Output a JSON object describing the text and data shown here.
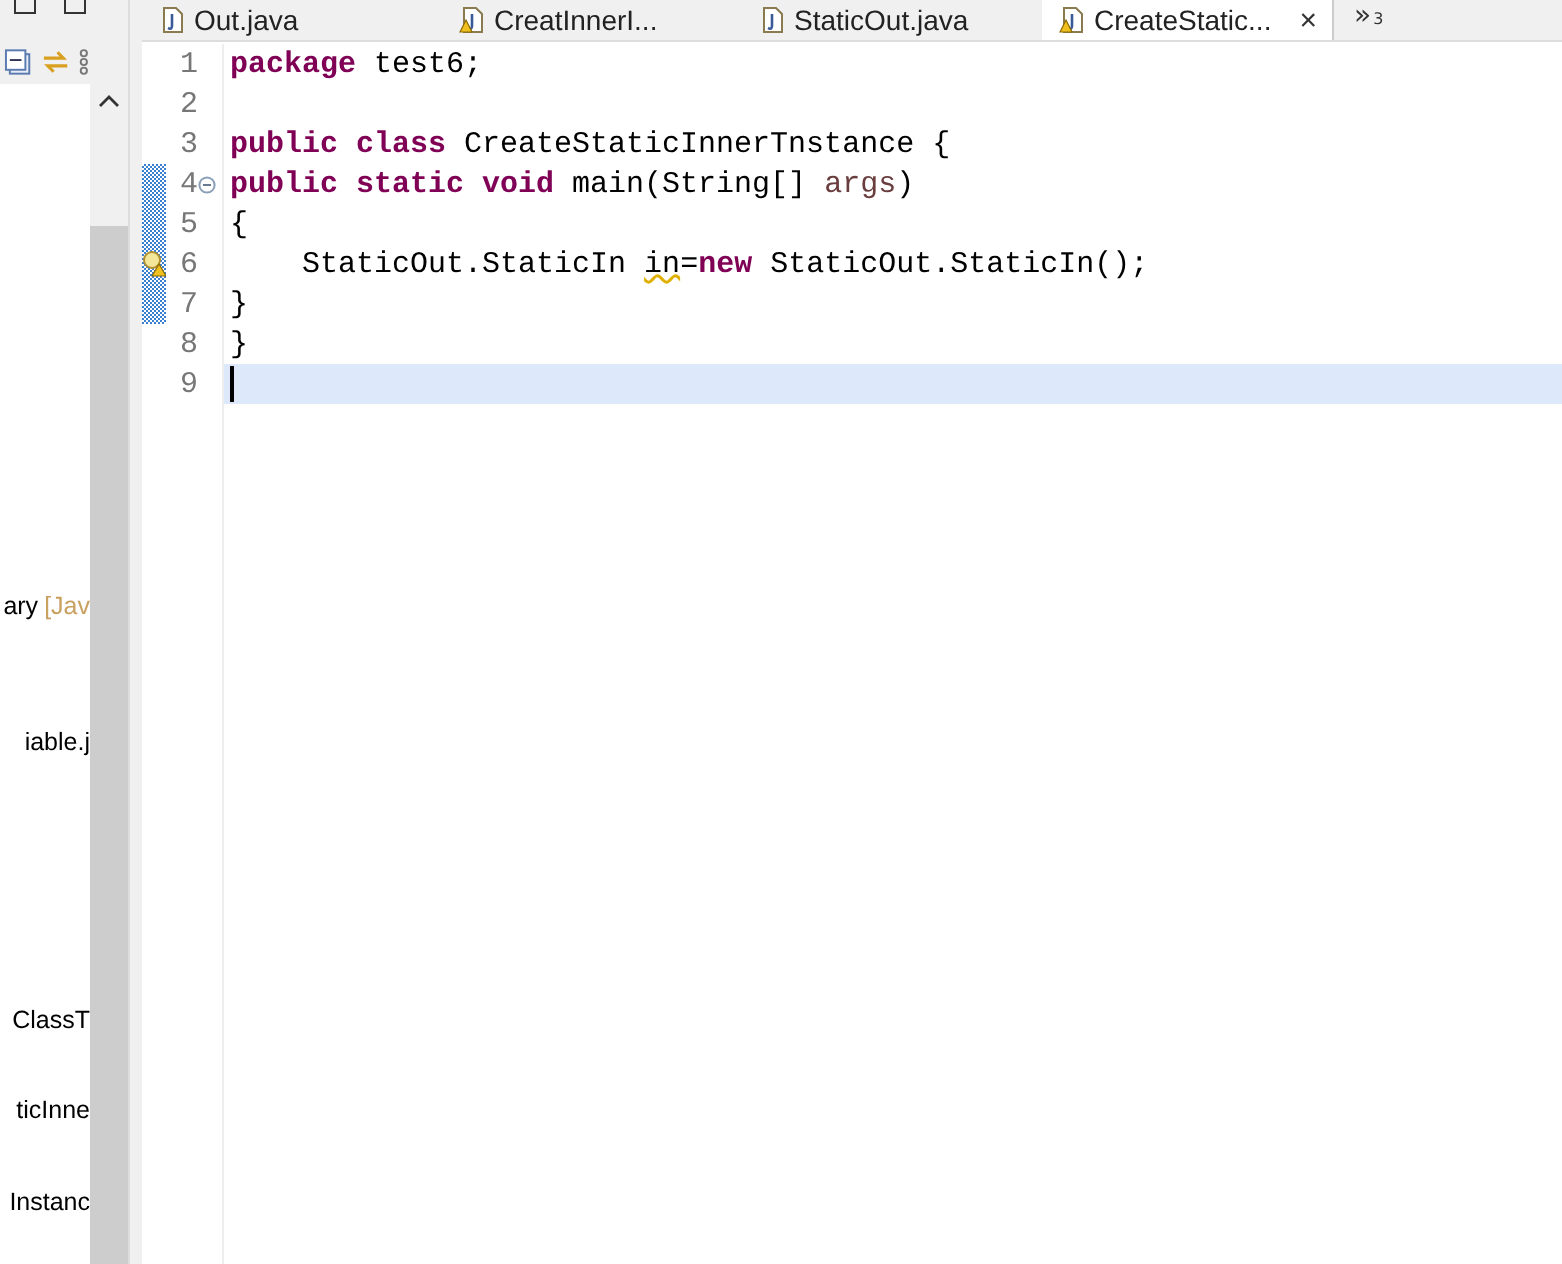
{
  "explorer": {
    "items": [
      {
        "text": "ary",
        "suffix": "[Jav"
      },
      {
        "text": "iable.j"
      },
      {
        "text": "ClassT"
      },
      {
        "text": "ticInne"
      },
      {
        "text": "Instanc"
      }
    ]
  },
  "tabs": [
    {
      "label": "Out.java",
      "selected": false,
      "warning": false
    },
    {
      "label": "CreatInnerI...",
      "selected": false,
      "warning": true
    },
    {
      "label": "StaticOut.java",
      "selected": false,
      "warning": false
    },
    {
      "label": "CreateStatic...",
      "selected": true,
      "warning": true
    }
  ],
  "tab_close": "×",
  "tab_overflow": {
    "symbol": "»",
    "count": "3"
  },
  "code_lines": [
    {
      "number": "1",
      "fold": false,
      "changed": false,
      "warning": false,
      "current": false,
      "segments": [
        {
          "kind": "keyword",
          "text": "package"
        },
        {
          "kind": "plain",
          "text": " test6;"
        }
      ]
    },
    {
      "number": "2",
      "fold": false,
      "changed": false,
      "warning": false,
      "current": false
    },
    {
      "number": "3",
      "fold": false,
      "changed": false,
      "warning": false,
      "current": false,
      "segments": [
        {
          "kind": "keyword",
          "text": "public class"
        },
        {
          "kind": "plain",
          "text": " CreateStaticInnerTnstance {"
        }
      ]
    },
    {
      "number": "4",
      "fold": true,
      "changed": true,
      "warning": false,
      "current": false,
      "segments": [
        {
          "kind": "keyword",
          "text": "public static void"
        },
        {
          "kind": "plain",
          "text": " main(String[] "
        },
        {
          "kind": "param",
          "text": "args"
        },
        {
          "kind": "plain",
          "text": ")"
        }
      ]
    },
    {
      "number": "5",
      "fold": false,
      "changed": true,
      "warning": false,
      "current": false,
      "segments": [
        {
          "kind": "plain",
          "text": "{"
        }
      ]
    },
    {
      "number": "6",
      "fold": false,
      "changed": true,
      "warning": true,
      "current": false,
      "segments": [
        {
          "kind": "plain",
          "text": "    StaticOut.StaticIn "
        },
        {
          "kind": "warned",
          "text": "in"
        },
        {
          "kind": "plain",
          "text": "="
        },
        {
          "kind": "keyword",
          "text": "new"
        },
        {
          "kind": "plain",
          "text": " StaticOut.StaticIn();"
        }
      ]
    },
    {
      "number": "7",
      "fold": false,
      "changed": true,
      "warning": false,
      "current": false,
      "segments": [
        {
          "kind": "plain",
          "text": "}"
        }
      ]
    },
    {
      "number": "8",
      "fold": false,
      "changed": false,
      "warning": false,
      "current": false,
      "segments": [
        {
          "kind": "plain",
          "text": "}"
        }
      ]
    },
    {
      "number": "9",
      "fold": false,
      "changed": false,
      "warning": false,
      "current": true
    }
  ]
}
